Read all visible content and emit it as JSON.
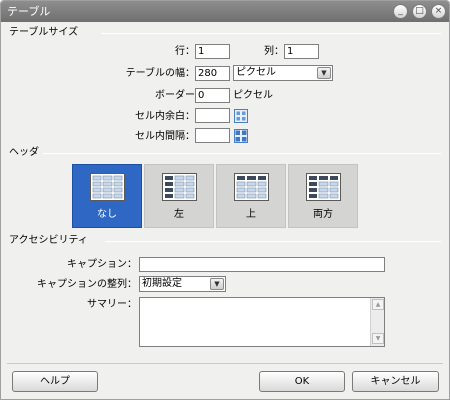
{
  "window": {
    "title": "テーブル",
    "buttons": [
      "_",
      "□",
      "×"
    ]
  },
  "table_size": {
    "section_label": "テーブルサイズ",
    "rows_label": "行：",
    "rows_value": "1",
    "cols_label": "列：",
    "cols_value": "1",
    "width_label": "テーブルの幅：",
    "width_value": "280",
    "width_unit": "ピクセル",
    "border_label": "ボーダー",
    "border_value": "0",
    "border_unit": "ピクセル",
    "padding_label": "セル内余白：",
    "padding_value": "",
    "spacing_label": "セル内間隔：",
    "spacing_value": ""
  },
  "header": {
    "section_label": "ヘッダ",
    "options": [
      {
        "label": "なし",
        "selected": true,
        "icon": "table-no-header-icon"
      },
      {
        "label": "左",
        "selected": false,
        "icon": "table-left-header-icon"
      },
      {
        "label": "上",
        "selected": false,
        "icon": "table-top-header-icon"
      },
      {
        "label": "両方",
        "selected": false,
        "icon": "table-both-headers-icon"
      }
    ]
  },
  "accessibility": {
    "section_label": "アクセシビリティ",
    "caption_label": "キャプション：",
    "caption_value": "",
    "caption_align_label": "キャプションの整列：",
    "caption_align_value": "初期設定",
    "summary_label": "サマリー："
  },
  "footer": {
    "help_label": "ヘルプ",
    "ok_label": "OK",
    "cancel_label": "キャンセル"
  },
  "colors": {
    "selected": "#2f68c4",
    "titlebar": "#7f7f7f",
    "panel": "#f0f0ee"
  }
}
